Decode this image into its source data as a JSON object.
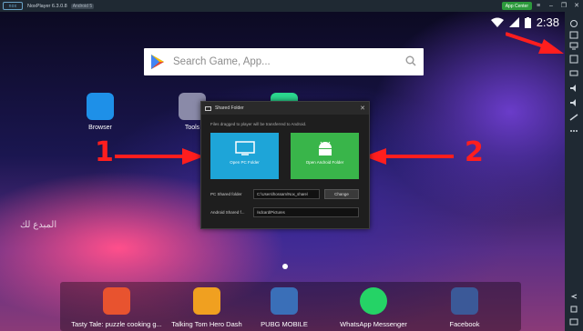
{
  "titlebar": {
    "logo": "nox",
    "app_name": "NoxPlayer 6.3.0.8",
    "android_badge": "Android 5",
    "app_center": "App Center",
    "btns": [
      "≡",
      "–",
      "❐",
      "✕"
    ]
  },
  "status": {
    "time": "2:38"
  },
  "search": {
    "placeholder": "Search Game, App..."
  },
  "desktop_apps": [
    {
      "label": "Browser"
    },
    {
      "label": "Tools"
    }
  ],
  "watermark": "المبدع لك",
  "dock": [
    {
      "label": "Tasty Tale: puzzle cooking g..."
    },
    {
      "label": "Talking Tom Hero Dash"
    },
    {
      "label": "PUBG MOBILE"
    },
    {
      "label": "WhatsApp Messenger"
    },
    {
      "label": "Facebook"
    }
  ],
  "dialog": {
    "title": "Shared Folder",
    "close": "✕",
    "description": "Files dragged to player will be transferred to Android.",
    "open_pc": "Open PC Folder",
    "open_android": "Open Android Folder",
    "pc_label": "PC Shared folder",
    "pc_value": "C:\\Users\\hossam\\Nox_share\\",
    "change": "Change",
    "android_label": "Android Shared f...",
    "android_value": "/sdcard/Pictures"
  },
  "annotations": {
    "one": "1",
    "two": "2"
  },
  "colors": {
    "pc_button": "#1ea5d8",
    "android_button": "#39b54a",
    "arrow": "#ff1e1e"
  }
}
